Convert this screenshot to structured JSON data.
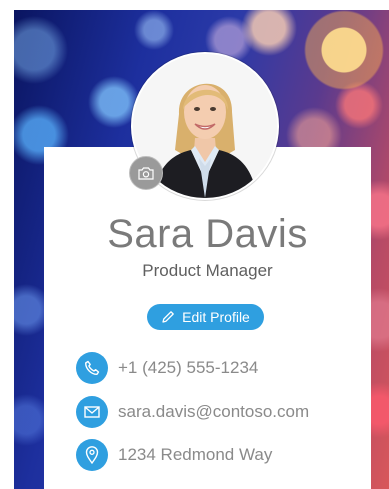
{
  "profile": {
    "name": "Sara Davis",
    "title": "Product Manager",
    "edit_label": "Edit Profile"
  },
  "contact": {
    "phone": "+1 (425) 555-1234",
    "email": "sara.davis@contoso.com",
    "address": "1234 Redmond Way"
  },
  "icons": {
    "camera": "camera-icon",
    "edit": "pencil-icon",
    "phone": "phone-icon",
    "email": "mail-icon",
    "address": "location-pin-icon"
  },
  "colors": {
    "accent": "#2f9fe0",
    "name_text": "#7a7a7a",
    "detail_text": "#8a8a8a",
    "camera_button": "#9a9a9a"
  }
}
